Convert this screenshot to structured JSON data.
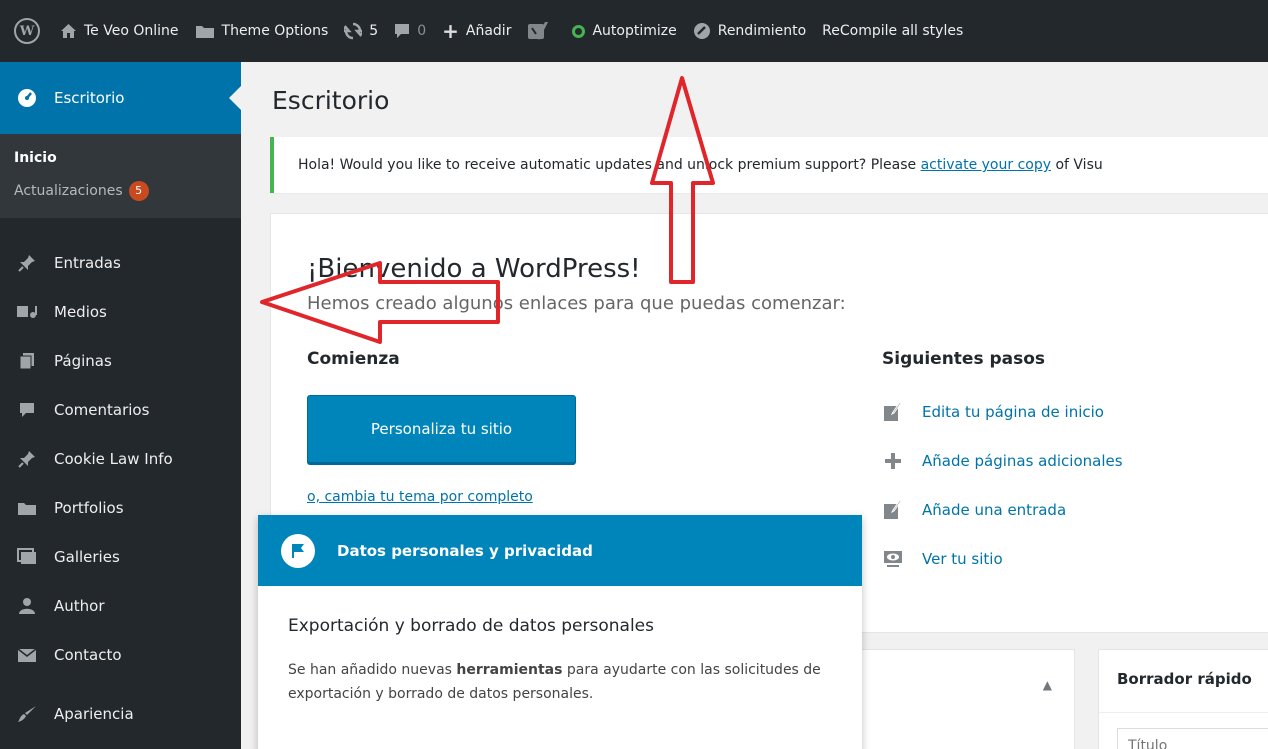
{
  "adminbar": {
    "site_name": "Te Veo Online",
    "theme_options": "Theme Options",
    "updates_count": "5",
    "comments_count": "0",
    "add_new": "Añadir",
    "autoptimize": "Autoptimize",
    "performance": "Rendimiento",
    "recompile": "ReCompile all styles"
  },
  "sidebar": {
    "current": "Escritorio",
    "sub_home": "Inicio",
    "sub_updates": "Actualizaciones",
    "updates_badge": "5",
    "items": [
      {
        "label": "Entradas",
        "icon": "pin-icon"
      },
      {
        "label": "Medios",
        "icon": "media-icon"
      },
      {
        "label": "Páginas",
        "icon": "pages-icon"
      },
      {
        "label": "Comentarios",
        "icon": "comment-icon"
      },
      {
        "label": "Cookie Law Info",
        "icon": "pin-icon"
      },
      {
        "label": "Portfolios",
        "icon": "folder-icon"
      },
      {
        "label": "Galleries",
        "icon": "gallery-icon"
      },
      {
        "label": "Author",
        "icon": "user-icon"
      },
      {
        "label": "Contacto",
        "icon": "mail-icon"
      },
      {
        "label": "Apariencia",
        "icon": "brush-icon"
      }
    ]
  },
  "main": {
    "title": "Escritorio",
    "notice_text": "Hola! Would you like to receive automatic updates and unlock premium support? Please",
    "notice_link": "activate your copy",
    "notice_tail": "of Visu",
    "welcome": {
      "title": "¡Bienvenido a WordPress!",
      "about": "Hemos creado algunos enlaces para que puedas comenzar:",
      "start_title": "Comienza",
      "customize_button": "Personaliza tu sitio",
      "alt_link": "o, cambia tu tema por completo",
      "next_title": "Siguientes pasos",
      "next_steps": [
        {
          "label": "Edita tu página de inicio",
          "icon": "edit-icon"
        },
        {
          "label": "Añade páginas adicionales",
          "icon": "plus-icon"
        },
        {
          "label": "Añade una entrada",
          "icon": "edit-icon"
        },
        {
          "label": "Ver tu sitio",
          "icon": "view-icon"
        }
      ]
    },
    "quick_draft": {
      "title": "Borrador rápido",
      "title_placeholder": "Título"
    }
  },
  "pointer": {
    "header": "Datos personales y privacidad",
    "heading": "Exportación y borrado de datos personales",
    "body_pre": "Se han añadido nuevas ",
    "body_bold": "herramientas",
    "body_post": " para ayudarte con las solicitudes de exportación y borrado de datos personales."
  },
  "colors": {
    "admin_dark": "#23282d",
    "submenu": "#32373c",
    "accent_blue": "#0073aa",
    "button_blue": "#0085ba",
    "notice_green": "#46b450",
    "badge_orange": "#ca4a1f",
    "annotation_red": "#e0262b"
  }
}
